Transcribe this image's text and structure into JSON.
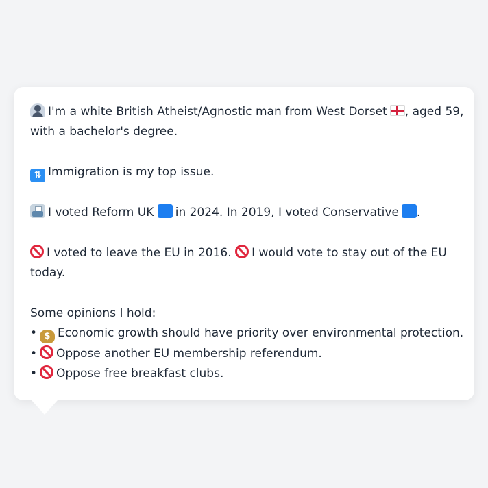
{
  "profile": {
    "identity_line1": "I'm a white British Atheist/Agnostic man from West Dorset",
    "identity_line1_suffix": ", aged 59,",
    "identity_line2": "with a bachelor's degree.",
    "top_issue": "Immigration is my top issue.",
    "vote_part1": "I voted Reform UK",
    "vote_part2": "in 2024. In 2019, I voted Conservative",
    "vote_part3": ".",
    "eu_part1": "I voted to leave the EU in 2016.",
    "eu_part2": "I would vote to stay out of the EU",
    "eu_line2": "today.",
    "opinions_heading": "Some opinions I hold:",
    "opinions": [
      {
        "bullet": "•",
        "icon": "money-bag-icon",
        "text": "Economic growth should have priority over environmental protection."
      },
      {
        "bullet": "•",
        "icon": "prohibited-icon",
        "text": "Oppose another EU membership referendum."
      },
      {
        "bullet": "•",
        "icon": "prohibited-icon",
        "text": "Oppose free breakfast clubs."
      }
    ]
  },
  "icons": {
    "identity": "bust-in-silhouette-icon",
    "flag": "england-flag-icon",
    "issue": "passport-control-icon",
    "vote": "ballot-box-icon",
    "party_color": "blue-square-icon",
    "eu": "prohibited-icon"
  },
  "colors": {
    "background": "#f3f4f6",
    "card": "#ffffff",
    "text": "#1f2937",
    "party_blue": "#1d7ef0",
    "prohibited_red": "#e0263d"
  }
}
